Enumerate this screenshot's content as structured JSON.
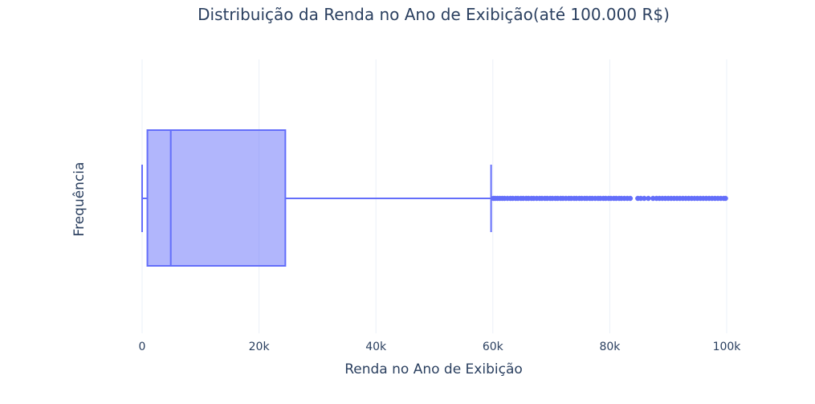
{
  "chart_data": {
    "type": "box",
    "title": "Distribuição da Renda no Ano de Exibição(até 100.000 R$)",
    "xlabel": "Renda no Ano de Exibição",
    "ylabel": "Frequência",
    "xlim": [
      0,
      100000
    ],
    "x_ticks": [
      {
        "value": 0,
        "label": "0"
      },
      {
        "value": 20000,
        "label": "20k"
      },
      {
        "value": 40000,
        "label": "40k"
      },
      {
        "value": 60000,
        "label": "60k"
      },
      {
        "value": 80000,
        "label": "80k"
      },
      {
        "value": 100000,
        "label": "100k"
      }
    ],
    "grid": true,
    "orientation": "horizontal",
    "box": {
      "lower_whisker": 0,
      "q1": 900,
      "median": 4900,
      "q3": 24500,
      "upper_whisker": 59700
    },
    "outliers": [
      60100,
      60400,
      60800,
      61200,
      61600,
      62000,
      62500,
      63000,
      63400,
      63900,
      64300,
      64800,
      65200,
      65700,
      66100,
      66600,
      67000,
      67500,
      68000,
      68400,
      68900,
      69300,
      69800,
      70200,
      70700,
      71100,
      71600,
      72000,
      72500,
      73000,
      73400,
      73900,
      74300,
      74800,
      75200,
      75700,
      76100,
      76600,
      77000,
      77500,
      78000,
      78400,
      78900,
      79300,
      79800,
      80200,
      80700,
      81100,
      81600,
      82000,
      82500,
      83000,
      83500,
      84800,
      85300,
      85900,
      86600,
      87400,
      88000,
      88500,
      89000,
      89500,
      90000,
      90500,
      91000,
      91500,
      92000,
      92500,
      93000,
      93500,
      94000,
      94500,
      95000,
      95500,
      96000,
      96500,
      97000,
      97500,
      98000,
      98500,
      99000,
      99500,
      99800
    ],
    "colors": {
      "box_line": "#636efa",
      "box_fill": "rgba(99,110,250,0.5)",
      "grid": "#ebf0f8",
      "text": "#2a3f5f"
    }
  }
}
